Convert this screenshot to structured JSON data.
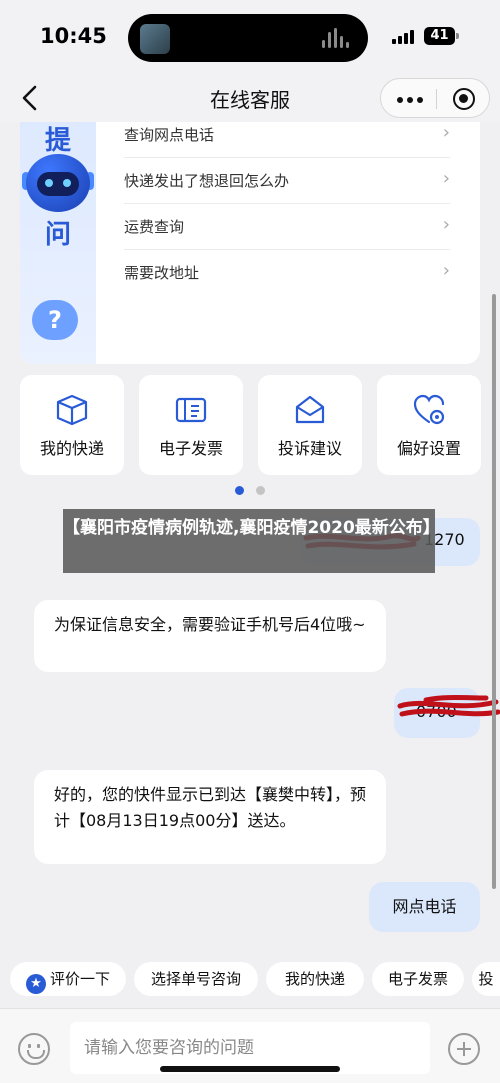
{
  "status_bar": {
    "time": "10:45",
    "battery": "41"
  },
  "nav": {
    "title": "在线客服"
  },
  "faq": {
    "items": [
      {
        "label": "查询网点电话"
      },
      {
        "label": "快递发出了想退回怎么办"
      },
      {
        "label": "运费查询"
      },
      {
        "label": "需要改地址"
      }
    ],
    "side_chars": [
      "提",
      "问"
    ],
    "help_symbol": "?"
  },
  "quick_actions": [
    {
      "label": "我的快递",
      "icon": "package-icon"
    },
    {
      "label": "电子发票",
      "icon": "invoice-icon"
    },
    {
      "label": "投诉建议",
      "icon": "mail-icon"
    },
    {
      "label": "偏好设置",
      "icon": "preference-settings-icon"
    }
  ],
  "messages": {
    "user_phone_visible": "1270",
    "bot_verify": "为保证信息安全，需要验证手机号后4位哦~",
    "user_last4_visible": "0700",
    "bot_delivered": "好的，您的快件显示已到达【襄樊中转】，预计【08月13日19点00分】送达。",
    "user_outlet_phone": "网点电话"
  },
  "overlay_banner": "【襄阳市疫情病例轨迹,襄阳疫情2020最新公布】",
  "chips": [
    "评价一下",
    "选择单号咨询",
    "我的快递",
    "电子发票",
    "投"
  ],
  "input": {
    "placeholder": "请输入您要咨询的问题"
  },
  "colors": {
    "accent": "#2a5bd7",
    "user_bubble": "#dbe8fb",
    "redaction": "#c0101a"
  }
}
